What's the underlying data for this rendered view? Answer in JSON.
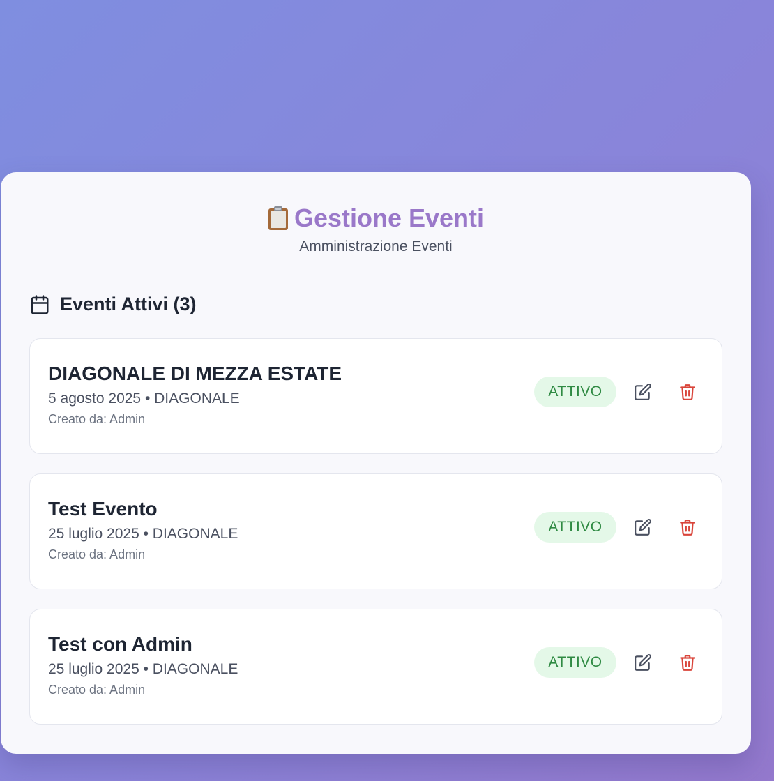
{
  "header": {
    "title": "Gestione Eventi",
    "title_icon": "clipboard-icon",
    "subtitle": "Amministrazione Eventi"
  },
  "section": {
    "title": "Eventi Attivi (3)",
    "icon": "calendar-icon"
  },
  "events": [
    {
      "name": "DIAGONALE DI MEZZA ESTATE",
      "meta": "5 agosto 2025 • DIAGONALE",
      "creator": "Creato da: Admin",
      "status": "ATTIVO"
    },
    {
      "name": "Test Evento",
      "meta": "25 luglio 2025 • DIAGONALE",
      "creator": "Creato da: Admin",
      "status": "ATTIVO"
    },
    {
      "name": "Test con Admin",
      "meta": "25 luglio 2025 • DIAGONALE",
      "creator": "Creato da: Admin",
      "status": "ATTIVO"
    }
  ],
  "colors": {
    "title": "#9a78c9",
    "status_bg": "#e4f8e8",
    "status_text": "#2f8a43",
    "delete": "#d9443a",
    "edit": "#4a5060"
  }
}
